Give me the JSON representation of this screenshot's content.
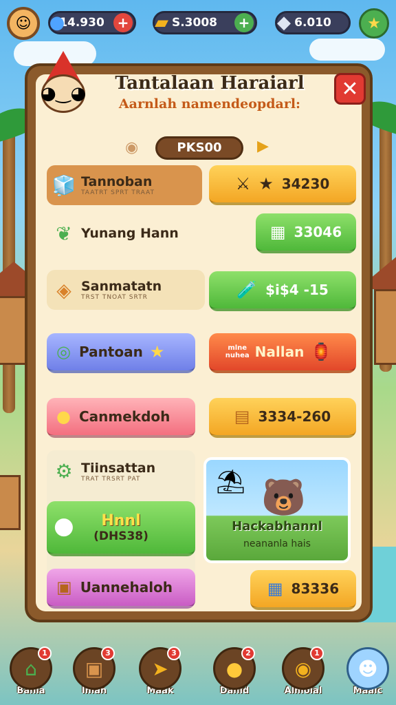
{
  "topbar": {
    "currency1": "14.930",
    "currency2": "S.3008",
    "currency3": "6.010",
    "colors": {
      "plus1": "#e2473d",
      "plus2": "#4caf50"
    }
  },
  "panel": {
    "title": "Tantalaan Haraiarl",
    "subtitle": "Aarnlah namendeopdarl:",
    "close_icon": "close-icon",
    "page_label": "PKS00"
  },
  "rows": [
    {
      "label": "Tannoban",
      "sub": "TAATRT SPRT TRAAT",
      "right_value": "34230"
    },
    {
      "label": "Yunang Hann",
      "right_value": "33046"
    },
    {
      "label": "Sanmatatn",
      "sub": "TRST TNOAT SRTR",
      "right_value": "$i$4 -15"
    },
    {
      "label": "Pantoan",
      "right_label": "Nallan",
      "right_tag1": "mlne",
      "right_tag2": "nuhea"
    },
    {
      "label": "Canmekdoh",
      "right_value": "3334-260"
    },
    {
      "label": "Tiinsattan",
      "sub": "TRAT TRSRT PAT",
      "green_label": "Hnnl",
      "green_sub": "(DHS38)"
    },
    {
      "label": "Uannehaloh",
      "right_value": "83336"
    }
  ],
  "promo": {
    "title": "Hackabhannl",
    "subtitle": "neananla hais"
  },
  "nav": [
    {
      "label": "Banla",
      "badge": "1"
    },
    {
      "label": "Iman",
      "badge": "3"
    },
    {
      "label": "Maak",
      "badge": "3"
    },
    {
      "label": "Danid",
      "badge": "2"
    },
    {
      "label": "Almoial",
      "badge": "1"
    },
    {
      "label": "Maaic"
    }
  ]
}
